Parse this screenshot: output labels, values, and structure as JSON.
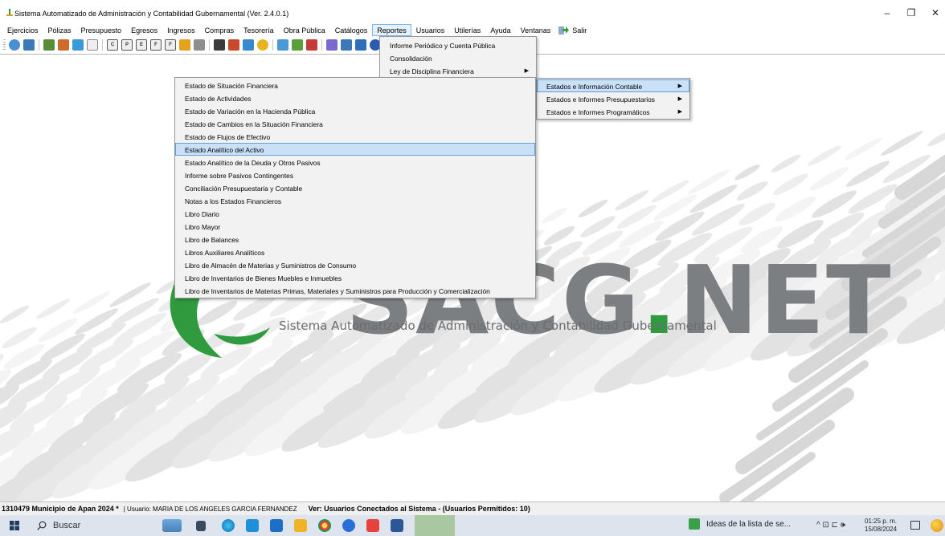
{
  "window": {
    "title": "Sistema Automatizado de Administración y Contabilidad Gubernamental  (Ver. 2.4.0.1)",
    "minimize": "–",
    "maximize": "❐",
    "close": "✕"
  },
  "menubar": {
    "items": [
      "Ejercicios",
      "Pólizas",
      "Presupuesto",
      "Egresos",
      "Ingresos",
      "Compras",
      "Tesorería",
      "Obra Pública",
      "Catálogos",
      "Reportes",
      "Usuarios",
      "Utilerías",
      "Ayuda",
      "Ventanas"
    ],
    "active": "Reportes",
    "salir": "Salir"
  },
  "toolbar": {
    "box_letters": [
      "C",
      "P",
      "E",
      "F",
      "F"
    ]
  },
  "background": {
    "logo_main": "SACG",
    "logo_dot": ".",
    "logo_suffix": "NET",
    "subtitle": "Sistema Automatizado de Administración y Contabilidad Gubernamental",
    "accent_green": "#2f9a3e",
    "logo_gray": "#7c7f82"
  },
  "menu_reportes": {
    "items": [
      {
        "label": "Informe Periódico y Cuenta Pública",
        "submenu": false
      },
      {
        "label": "Consolidación",
        "submenu": false
      },
      {
        "label": "Ley de Disciplina Financiera",
        "submenu": true
      }
    ]
  },
  "menu_ley": {
    "items": [
      {
        "label": "Estados e Información Contable",
        "submenu": true,
        "highlighted": true
      },
      {
        "label": "Estados e Informes Presupuestarios",
        "submenu": true
      },
      {
        "label": "Estados e Informes Programáticos",
        "submenu": true
      }
    ]
  },
  "menu_estados": {
    "items": [
      {
        "label": "Estado de Situación Financiera"
      },
      {
        "label": "Estado de Actividades"
      },
      {
        "label": "Estado de Variación en la Hacienda Pública"
      },
      {
        "label": "Estado de Cambios en la Situación Financiera"
      },
      {
        "label": "Estado de Flujos de Efectivo"
      },
      {
        "label": "Estado Analítico del Activo",
        "highlighted": true
      },
      {
        "label": "Estado Analítico de la Deuda y Otros Pasivos"
      },
      {
        "label": "Informe sobre Pasivos Contingentes"
      },
      {
        "label": "Conciliación Presupuestaria y Contable"
      },
      {
        "label": "Notas a los Estados Financieros"
      },
      {
        "label": "Libro Diario"
      },
      {
        "label": "Libro Mayor"
      },
      {
        "label": "Libro de Balances"
      },
      {
        "label": "Libros Auxiliares Analíticos"
      },
      {
        "label": "Libro de Almacén de Materias y Suministros de Consumo"
      },
      {
        "label": "Libro de Inventarios de Bienes Muebles e Inmuebles"
      },
      {
        "label": "Libro de Inventarios de Materias Primas, Materiales y Suministros para Producción y Comercialización"
      }
    ]
  },
  "statusbar": {
    "entity": "1310479 Municipio de Apan  2024   *",
    "user": "|  Usuario: MARIA DE LOS ANGELES GARCIA FERNANDEZ",
    "connected": "Ver: Usuarios Conectados al Sistema  - (Usuarios Permitidos: 10)"
  },
  "taskbar": {
    "search_label": "Buscar",
    "news": "Ideas de la lista de se...",
    "tray": "^  ⊡  ⊏  🕪",
    "time": "01:25 p. m.",
    "date": "15/08/2024"
  }
}
